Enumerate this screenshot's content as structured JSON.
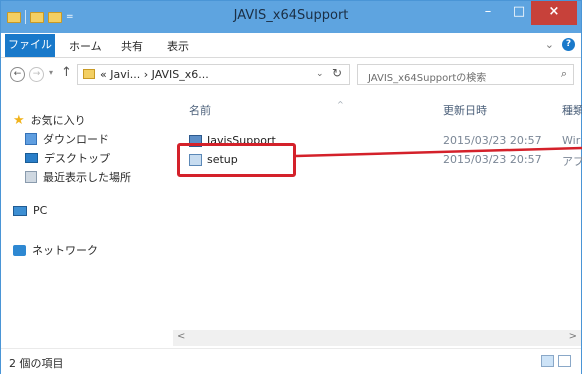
{
  "window": {
    "title": "JAVIS_x64Support"
  },
  "title_buttons": {
    "minimize": "–",
    "maximize": "□",
    "close": "×"
  },
  "ribbon": {
    "tabs": [
      "ファイル",
      "ホーム",
      "共有",
      "表示"
    ],
    "expand": "⌄",
    "help": "?"
  },
  "address": {
    "path": "« Javi... › JAVIS_x6...",
    "dropdown": "⌄",
    "refresh": "↻",
    "back": "←",
    "forward": "→",
    "up": "↑",
    "recent": "▾"
  },
  "search": {
    "placeholder": "JAVIS_x64Supportの検索",
    "icon": "⌕"
  },
  "nav": {
    "favorites": "お気に入り",
    "items": [
      "ダウンロード",
      "デスクトップ",
      "最近表示した場所"
    ],
    "pc": "PC",
    "network": "ネットワーク"
  },
  "columns": {
    "name": "名前",
    "date": "更新日時",
    "type": "種類"
  },
  "files": [
    {
      "name": "JavisSupport",
      "date": "2015/03/23 20:57",
      "type": "Wir"
    },
    {
      "name": "setup",
      "date": "2015/03/23 20:57",
      "type": "アプ"
    }
  ],
  "scrollbar": {
    "left": "<",
    "right": ">"
  },
  "status": {
    "count": "2 個の項目"
  },
  "colors": {
    "accent": "#1979ca",
    "title_bar": "#5ea4e0",
    "close": "#c7413a",
    "highlight": "#d4212a"
  }
}
